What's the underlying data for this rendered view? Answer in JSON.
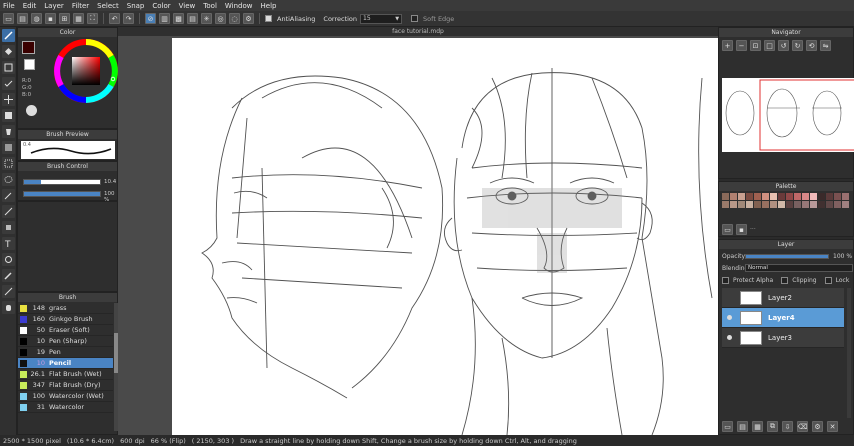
{
  "menu": [
    "File",
    "Edit",
    "Layer",
    "Filter",
    "Select",
    "Snap",
    "Color",
    "View",
    "Tool",
    "Window",
    "Help"
  ],
  "toolbar": {
    "antialiasing_label": "AntiAliasing",
    "correction_label": "Correction",
    "correction_value": "15",
    "soft_edge_label": "Soft Edge"
  },
  "document": {
    "title": "face tutorial.mdp"
  },
  "color_panel": {
    "title": "Color",
    "r_label": "R:0",
    "g_label": "G:0",
    "b_label": "B:0",
    "fg_color": "#2a0000"
  },
  "brush_preview": {
    "title": "Brush Preview",
    "size_label": "0.4"
  },
  "brush_control": {
    "title": "Brush Control",
    "size_value": "10.4",
    "opacity_value": "100 %"
  },
  "brush_panel": {
    "title": "Brush",
    "items": [
      {
        "size": "148",
        "name": "grass",
        "color": "#e8e040"
      },
      {
        "size": "160",
        "name": "Ginkgo Brush",
        "color": "#3b3bd0"
      },
      {
        "size": "50",
        "name": "Eraser (Soft)",
        "color": "#ffffff"
      },
      {
        "size": "10",
        "name": "Pen (Sharp)",
        "color": "#000000"
      },
      {
        "size": "19",
        "name": "Pen",
        "color": "#000000"
      },
      {
        "size": "10",
        "name": "Pencil",
        "color": "#111111",
        "selected": true
      },
      {
        "size": "26.1",
        "name": "Flat Brush (Wet)",
        "color": "#c8ec5a"
      },
      {
        "size": "347",
        "name": "Flat Brush (Dry)",
        "color": "#c8ec5a"
      },
      {
        "size": "100",
        "name": "Watercolor (Wet)",
        "color": "#7fd0f0"
      },
      {
        "size": "31",
        "name": "Watercolor",
        "color": "#7fd0f0"
      }
    ]
  },
  "navigator": {
    "title": "Navigator"
  },
  "palette": {
    "title": "Palette",
    "colors": [
      "#8a6a5a",
      "#b08070",
      "#c8a090",
      "#7a4a40",
      "#a06050",
      "#d09080",
      "#e8c0b0",
      "#6a3a3a",
      "#904848",
      "#c06868",
      "#d88888",
      "#f0b8b8",
      "#3a2a2a",
      "#5a3a3a",
      "#7a5050",
      "#9a7070",
      "#9a7a6a",
      "#b89888",
      "#a08878",
      "#c8b0a0",
      "#806050",
      "#987060",
      "#b09080",
      "#d0b8a8",
      "#5a4040",
      "#786060",
      "#987878",
      "#b89898",
      "#403030",
      "#604848",
      "#806060",
      "#a08080"
    ]
  },
  "layer_panel": {
    "title": "Layer",
    "opacity_label": "Opacity",
    "opacity_value": "100 %",
    "blending_label": "Blending",
    "blending_value": "Normal",
    "protect_alpha": "Protect Alpha",
    "clipping": "Clipping",
    "lock": "Lock",
    "layers": [
      {
        "name": "Layer2",
        "visible": false,
        "selected": false
      },
      {
        "name": "Layer4",
        "visible": true,
        "selected": true
      },
      {
        "name": "Layer3",
        "visible": true,
        "selected": false
      }
    ]
  },
  "status": {
    "size": "2500 * 1500 pixel",
    "phys": "(10.6 * 6.4cm)",
    "dpi": "600 dpi",
    "zoom": "66 % (Flip)",
    "coords": "( 2150, 303 )",
    "hint": "Draw a straight line by holding down Shift, Change a brush size by holding down Ctrl, Alt, and dragging"
  }
}
